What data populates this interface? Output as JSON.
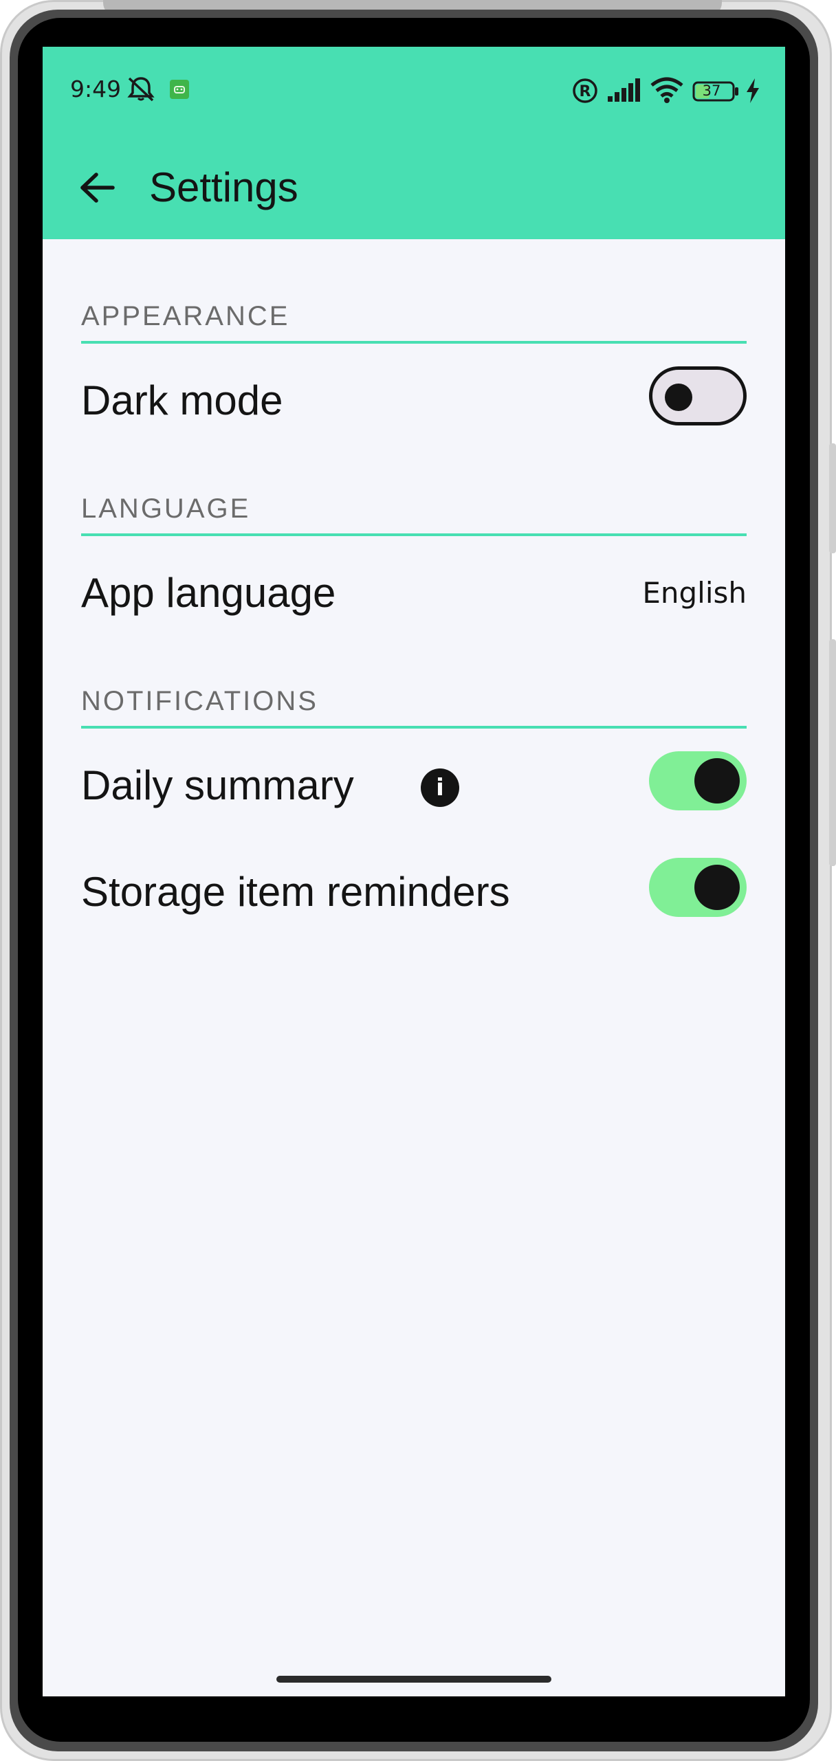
{
  "status_bar": {
    "time": "9:49",
    "battery_level": "37",
    "icons": [
      "bell-off-icon",
      "android-notification-icon",
      "registered-icon",
      "signal-icon",
      "wifi-icon",
      "battery-icon",
      "charging-icon"
    ]
  },
  "app_bar": {
    "title": "Settings",
    "back_icon": "arrow-left-icon"
  },
  "sections": {
    "appearance": {
      "header": "APPEARANCE",
      "dark_mode": {
        "label": "Dark mode",
        "enabled": false
      }
    },
    "language": {
      "header": "LANGUAGE",
      "app_language": {
        "label": "App language",
        "value": "English"
      }
    },
    "notifications": {
      "header": "NOTIFICATIONS",
      "daily_summary": {
        "label": "Daily summary",
        "info_icon": "i",
        "enabled": true
      },
      "storage_reminders": {
        "label": "Storage item reminders",
        "enabled": true
      }
    }
  },
  "colors": {
    "accent": "#48dfb2",
    "toggle_on": "#80ef96",
    "toggle_off": "#e7e2ea",
    "background": "#f5f6fb",
    "text": "#141414",
    "section_header": "#6b6b6b"
  }
}
